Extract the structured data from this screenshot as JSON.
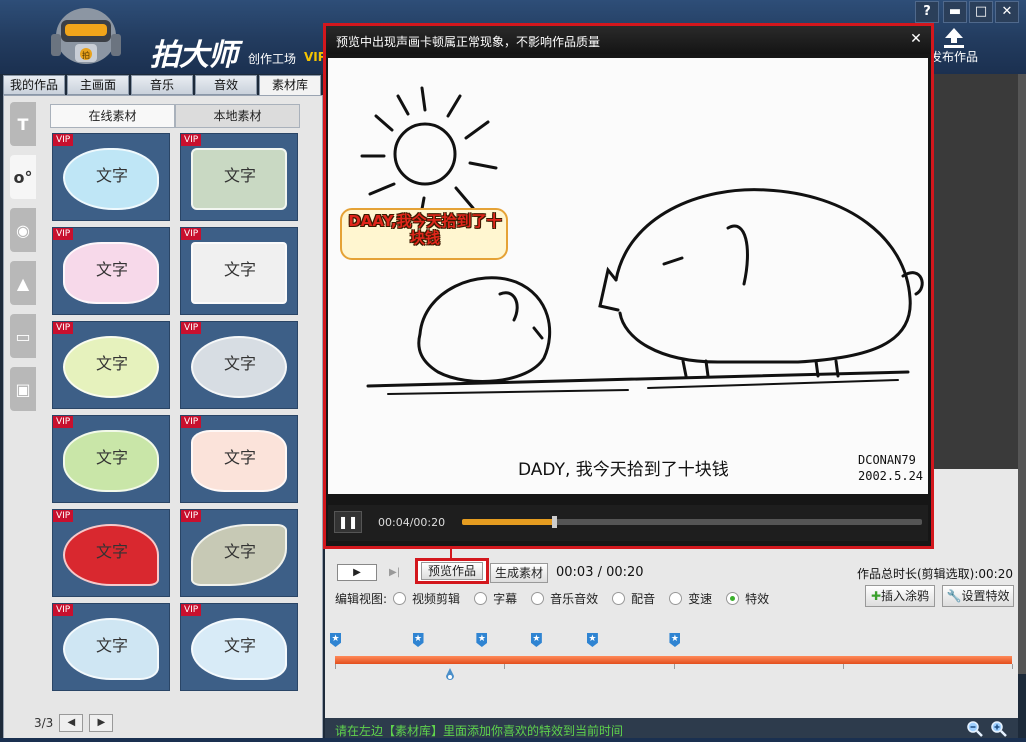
{
  "titlebar": {
    "app_title": "拍大师",
    "subtitle": "创作工场",
    "vip": "VIP",
    "help": "?",
    "minimize": "▬",
    "maximize": "□",
    "close": "✕",
    "publish_label": "发布作品"
  },
  "tabs": [
    {
      "label": "我的作品"
    },
    {
      "label": "主画面"
    },
    {
      "label": "音乐"
    },
    {
      "label": "音效"
    },
    {
      "label": "素材库"
    }
  ],
  "side_icons": [
    "T",
    "o°",
    "◉",
    "▲",
    "▭",
    "▣"
  ],
  "source_tabs": {
    "online": "在线素材",
    "local": "本地素材"
  },
  "materials": [
    {
      "label": "文字",
      "vip": "VIP",
      "style": "bubbles",
      "bg": "#bfe6f6"
    },
    {
      "label": "文字",
      "vip": "VIP",
      "style": "pentagon",
      "bg": "#c9d9c3"
    },
    {
      "label": "文字",
      "vip": "VIP",
      "style": "cloud-heart",
      "bg": "#f7d9ea"
    },
    {
      "label": "文字",
      "vip": "VIP",
      "style": "scroll",
      "bg": "#f0f0f0"
    },
    {
      "label": "文字",
      "vip": "VIP",
      "style": "flower-green",
      "bg": "#e6f2bd"
    },
    {
      "label": "文字",
      "vip": "VIP",
      "style": "flower-oval",
      "bg": "#d7dde3"
    },
    {
      "label": "文字",
      "vip": "VIP",
      "style": "leaf-frame",
      "bg": "#c9e6a8"
    },
    {
      "label": "文字",
      "vip": "VIP",
      "style": "torn-paper",
      "bg": "#fbe3da"
    },
    {
      "label": "文字",
      "vip": "VIP",
      "style": "red-heart",
      "bg": "#d9282f"
    },
    {
      "label": "文字",
      "vip": "VIP",
      "style": "leaf",
      "bg": "#c7c9b5"
    },
    {
      "label": "文字",
      "vip": "VIP",
      "style": "blue-heart",
      "bg": "#cfe6f3"
    },
    {
      "label": "文字",
      "vip": "VIP",
      "style": "dotted-heart",
      "bg": "#d8ebf7"
    }
  ],
  "pager": {
    "label": "3/3",
    "prev": "◀",
    "next": "▶"
  },
  "preview": {
    "title": "预览中出现声画卡顿属正常现象，不影响作品质量",
    "close": "✕",
    "bubble_text": "DAAY,我今天拾到了十块钱",
    "subtitle": "DADY, 我今天拾到了十块钱",
    "signature_line1": "DCONAN79",
    "signature_line2": "2002.5.24",
    "pause": "❚❚",
    "time": "00:04/00:20",
    "progress": 0.2
  },
  "controls": {
    "play": "▶",
    "next": "▶|",
    "preview_label": "预览作品",
    "generate_label": "生成素材",
    "time_readout": "00:03 / 00:20",
    "total_time": "作品总时长(剪辑选取):00:20"
  },
  "views": {
    "label": "编辑视图:",
    "options": [
      {
        "label": "视频剪辑",
        "selected": false
      },
      {
        "label": "字幕",
        "selected": false
      },
      {
        "label": "音乐音效",
        "selected": false
      },
      {
        "label": "配音",
        "selected": false
      },
      {
        "label": "变速",
        "selected": false
      },
      {
        "label": "特效",
        "selected": true
      }
    ],
    "insert_label": "插入涂鸦",
    "settings_label": "设置特效"
  },
  "timeline": {
    "marker_times_sec": [
      0,
      5.3,
      9.4,
      12.9,
      16.5,
      21.8
    ],
    "marker_icon": "★",
    "playhead_sec": 5.3,
    "duration_sec": 20
  },
  "status": {
    "text": "请在左边【素材库】里面添加你喜欢的特效到当前时间"
  },
  "colors": {
    "accent_red": "#d3171d",
    "progress_orange": "#e59c20",
    "timeline_orange": "#e24e1c",
    "status_green": "#5fd34c"
  }
}
